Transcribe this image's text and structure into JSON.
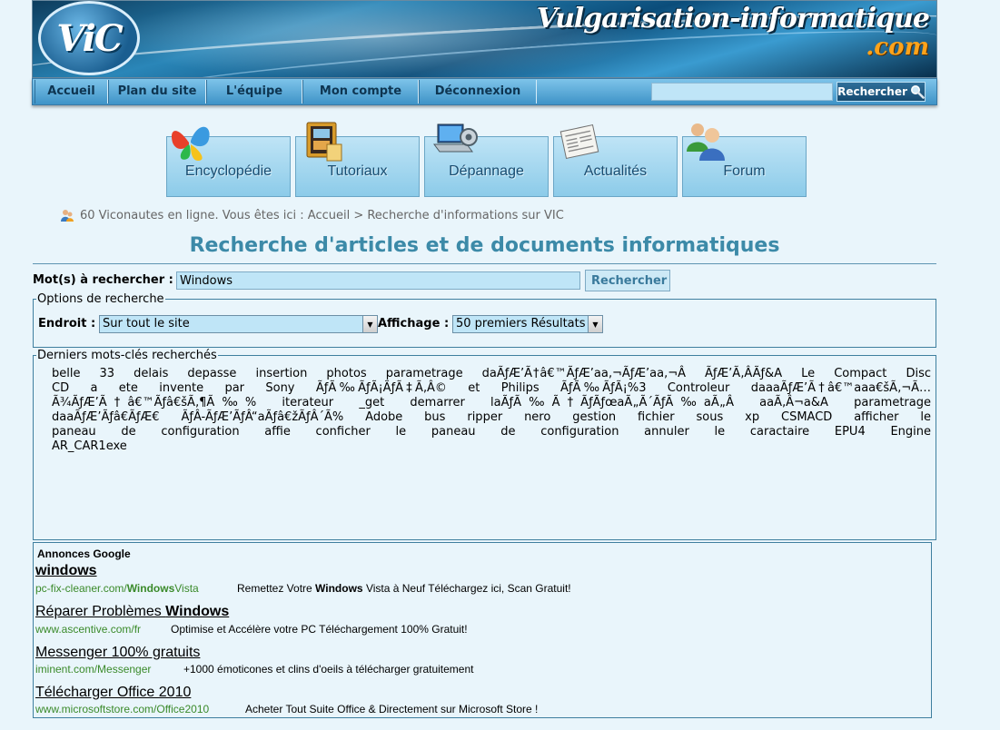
{
  "header": {
    "logo_text": "ViC",
    "site_name": "Vulgarisation-informatique",
    "site_tld": ".com"
  },
  "nav": {
    "items": [
      {
        "label": "Accueil"
      },
      {
        "label": "Plan du site"
      },
      {
        "label": "L'équipe"
      },
      {
        "label": "Mon compte"
      },
      {
        "label": "Déconnexion"
      }
    ],
    "search_value": "",
    "search_button": "Rechercher"
  },
  "categories": [
    {
      "label": "Encyclopédie",
      "icon": "butterfly-icon"
    },
    {
      "label": "Tutoriaux",
      "icon": "folder-film-icon"
    },
    {
      "label": "Dépannage",
      "icon": "laptop-gear-icon"
    },
    {
      "label": "Actualités",
      "icon": "newspaper-icon"
    },
    {
      "label": "Forum",
      "icon": "users-icon"
    }
  ],
  "breadcrumb": {
    "text": "60 Viconautes en ligne. Vous êtes ici : Accueil > Recherche d'informations sur VIC"
  },
  "page_title": "Recherche d'articles et de documents informatiques",
  "search_form": {
    "label": "Mot(s) à rechercher :",
    "value": "Windows",
    "submit": "Rechercher"
  },
  "options": {
    "legend": "Options de recherche",
    "endroit_label": "Endroit :",
    "endroit_value": "Sur tout le site",
    "affichage_label": "Affichage :",
    "affichage_value": "50 premiers Résultats"
  },
  "keywords": {
    "legend": "Derniers mots-clés recherchés",
    "text": "belle 33 delais depasse insertion photos parametrage daÃƒÆ’Ã†â€™ÃƒÆ’aa‚¬ÃƒÆ’aa‚¬Â ÃƒÆ’Ã‚ÂÃƒ&A Le Compact Disc CD a ete invente par Sony ÃƒÃ‰ÃƒÃ¡ÃƒÃ‡Ã‚Â© et Philips ÃƒÃ‰ÃƒÃ¡%3 Controleur daaaÃƒÆ’Ã†â€™aaa€šÃ‚¬Ã…Ã¾ÃƒÆ’Ã†â€™Ãƒâ€šÃ‚¶Ã‰% iterateur _get demarrer laÃƒÃ‰Ã†ÃƒÃƒœaÃ„Ã´ÃƒÃ‰aÃ„Â aaÃ‚Â¬a&A parametrage daaÃƒÆ’Ãƒâ€ÃƒÆ€ ÃƒÂ-ÃƒÆ’ÃƒÂ“aÃƒâ€žÃƒÂ´Ã% Adobe bus ripper nero gestion fichier sous xp CSMACD afficher le paneau de configuration affie conficher le paneau de configuration annuler le caractaire EPU4 Engine AR_CAR1exe"
  },
  "ads": {
    "heading": "Annonces Google",
    "items": [
      {
        "title_pre": "",
        "title_bold": "windows",
        "title_post": "",
        "url_pre": "pc-fix-cleaner.com/",
        "url_bold": "Windows",
        "url_post": "Vista",
        "desc_pre": "Remettez Votre ",
        "desc_bold": "Windows",
        "desc_post": " Vista à Neuf Téléchargez ici, Scan Gratuit!"
      },
      {
        "title_pre": "Réparer Problèmes ",
        "title_bold": "Windows",
        "title_post": "",
        "url_pre": "www.ascentive.com/fr",
        "url_bold": "",
        "url_post": "",
        "desc_pre": "Optimise et Accélère votre PC Téléchargement 100% Gratuit!",
        "desc_bold": "",
        "desc_post": ""
      },
      {
        "title_pre": "Messenger 100% gratuits",
        "title_bold": "",
        "title_post": "",
        "url_pre": "iminent.com/Messenger",
        "url_bold": "",
        "url_post": "",
        "desc_pre": "+1000 émoticones et clins d'oeils à télécharger gratuitement",
        "desc_bold": "",
        "desc_post": ""
      },
      {
        "title_pre": "Télécharger Office 2010",
        "title_bold": "",
        "title_post": "",
        "url_pre": "www.microsoftstore.com/Office2010",
        "url_bold": "",
        "url_post": "",
        "desc_pre": "Acheter Tout Suite Office & Directement sur Microsoft Store !",
        "desc_bold": "",
        "desc_post": ""
      }
    ]
  },
  "colors": {
    "page_bg": "#e9f5fb",
    "title": "#3c8aa8",
    "ad_url": "#3a8a2a",
    "border": "#3f7f9f"
  }
}
